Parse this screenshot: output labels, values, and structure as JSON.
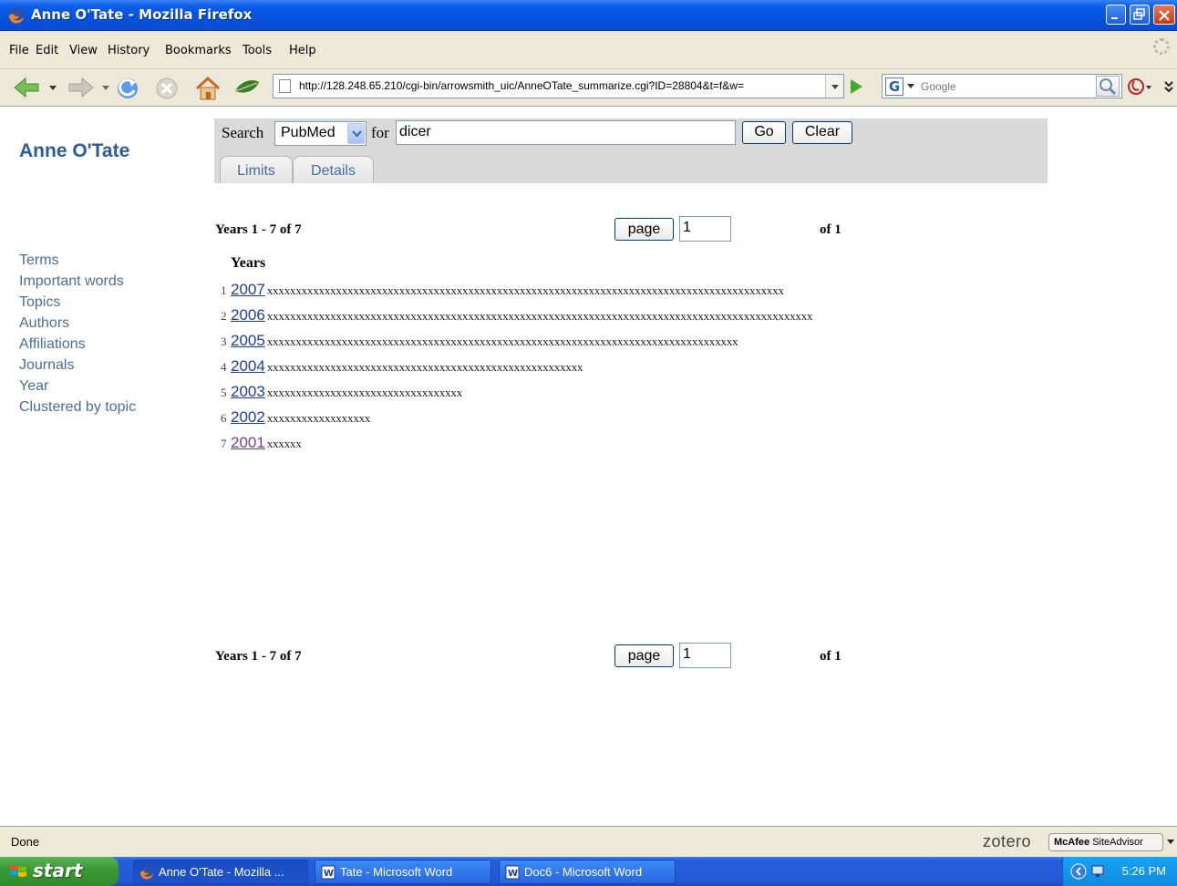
{
  "window": {
    "title": "Anne O'Tate - Mozilla Firefox"
  },
  "menubar": {
    "items": [
      "File",
      "Edit",
      "View",
      "History",
      "Bookmarks",
      "Tools",
      "Help"
    ]
  },
  "navbar": {
    "url": "http://128.248.65.210/cgi-bin/arrowsmith_uic/AnneOTate_summarize.cgi?ID=28804&t=f&w=",
    "search_engine": "G",
    "search_placeholder": "Google"
  },
  "page": {
    "brand": "Anne O'Tate",
    "sidenav": [
      "Terms",
      "Important words",
      "Topics",
      "Authors",
      "Affiliations",
      "Journals",
      "Year",
      "Clustered by topic"
    ],
    "search": {
      "search_label": "Search",
      "database": "PubMed",
      "for_label": "for",
      "query": "dicer",
      "go_label": "Go",
      "clear_label": "Clear",
      "tabs": [
        "Limits",
        "Details"
      ]
    },
    "pager": {
      "count_text": "Years 1 - 7 of 7",
      "page_button": "page",
      "page_value": "1",
      "of_text": "of 1"
    },
    "years_header": "Years",
    "years": [
      {
        "index": "1",
        "year": "2007",
        "bar": "xxxxxxxxxxxxxxxxxxxxxxxxxxxxxxxxxxxxxxxxxxxxxxxxxxxxxxxxxxxxxxxxxxxxxxxxxxxxxxxxxxxxxxxxxx"
      },
      {
        "index": "2",
        "year": "2006",
        "bar": "xxxxxxxxxxxxxxxxxxxxxxxxxxxxxxxxxxxxxxxxxxxxxxxxxxxxxxxxxxxxxxxxxxxxxxxxxxxxxxxxxxxxxxxxxxxxxxx"
      },
      {
        "index": "3",
        "year": "2005",
        "bar": "xxxxxxxxxxxxxxxxxxxxxxxxxxxxxxxxxxxxxxxxxxxxxxxxxxxxxxxxxxxxxxxxxxxxxxxxxxxxxxxxxx"
      },
      {
        "index": "4",
        "year": "2004",
        "bar": "xxxxxxxxxxxxxxxxxxxxxxxxxxxxxxxxxxxxxxxxxxxxxxxxxxxxxxx"
      },
      {
        "index": "5",
        "year": "2003",
        "bar": "xxxxxxxxxxxxxxxxxxxxxxxxxxxxxxxxxx"
      },
      {
        "index": "6",
        "year": "2002",
        "bar": "xxxxxxxxxxxxxxxxxx"
      },
      {
        "index": "7",
        "year": "2001",
        "bar": "xxxxxx"
      }
    ]
  },
  "statusbar": {
    "status": "Done",
    "zotero": "zotero",
    "mcafee_bold": "McAfee",
    "mcafee_text": "SiteAdvisor"
  },
  "taskbar": {
    "start_label": "start",
    "tasks": [
      "Anne O'Tate - Mozilla ...",
      "Tate - Microsoft Word",
      "Doc6 - Microsoft Word"
    ],
    "clock": "5:26 PM"
  },
  "colors": {
    "link": "#4a6d9c",
    "brand": "#2a5c9e",
    "search_panel": "#d9d9d9",
    "titlebar": "#0553df"
  }
}
